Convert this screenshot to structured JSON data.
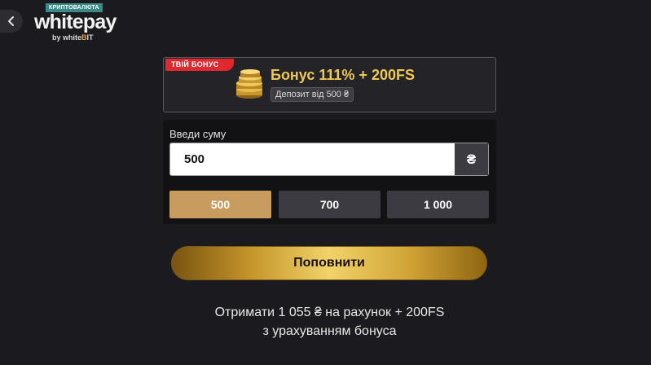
{
  "header": {
    "back_icon": "chevron-left-icon",
    "logo_badge": "КРИПТОВАЛЮТА",
    "logo_word": "whitepay",
    "logo_sub_prefix": "by white",
    "logo_sub_accent": "B",
    "logo_sub_suffix": "IT"
  },
  "bonus": {
    "tag": "ТВІЙ БОНУС",
    "icon": "coins-icon",
    "title": "Бонус 111% + 200FS",
    "deposit_note": "Депозит від 500 ₴",
    "accent_color": "#f0c850",
    "tag_color": "#e0282e"
  },
  "amount": {
    "label": "Введи суму",
    "value": "500",
    "currency": "₴",
    "presets": [
      {
        "label": "500",
        "active": true
      },
      {
        "label": "700",
        "active": false
      },
      {
        "label": "1 000",
        "active": false
      }
    ],
    "active_color": "#c89b5e"
  },
  "submit": {
    "label": "Поповнити"
  },
  "summary": {
    "line1": "Отримати 1 055 ₴ на рахунок + 200FS",
    "line2": "з урахуванням бонуса"
  }
}
